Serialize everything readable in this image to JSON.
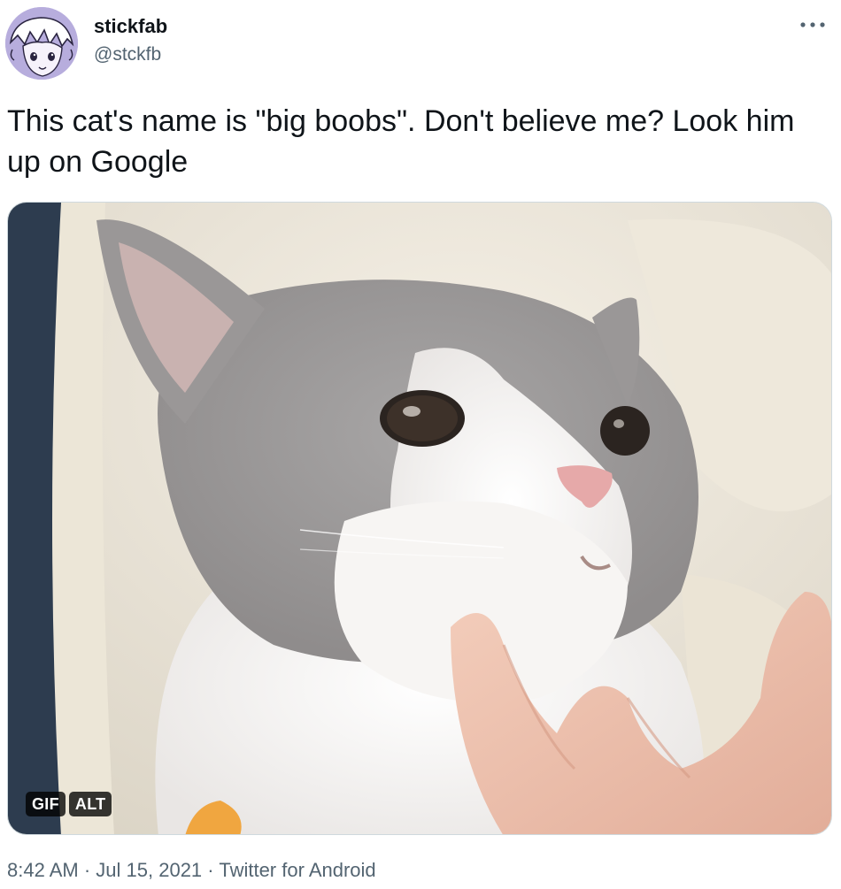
{
  "author": {
    "display_name": "stickfab",
    "handle": "@stckfb",
    "avatar_icon": "anime-character-avatar",
    "avatar_color": "#b7addd"
  },
  "more_icon": "more-horizontal-icon",
  "tweet": {
    "text": "This cat's name is \"big boobs\". Don't believe me? Look him up on Google"
  },
  "media": {
    "type": "gif",
    "badge_gif": "GIF",
    "badge_alt": "ALT"
  },
  "meta": {
    "time": "8:42 AM",
    "separator1": "·",
    "date": "Jul 15, 2021",
    "separator2": "·",
    "source": "Twitter for Android"
  },
  "colors": {
    "text_primary": "#0f1419",
    "text_secondary": "#536471",
    "border": "#cfd9de"
  }
}
